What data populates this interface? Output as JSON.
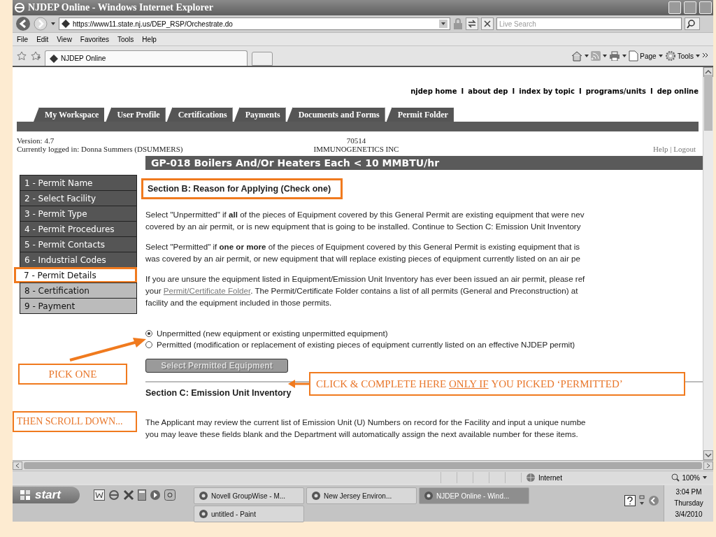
{
  "window": {
    "title": "NJDEP Online - Windows Internet Explorer"
  },
  "address_bar": {
    "url": "https://www11.state.nj.us/DEP_RSP/Orchestrate.do",
    "search_placeholder": "Live Search"
  },
  "menu": [
    "File",
    "Edit",
    "View",
    "Favorites",
    "Tools",
    "Help"
  ],
  "browser_tab": {
    "title": "NJDEP Online"
  },
  "command_bar": {
    "page": "Page",
    "tools": "Tools"
  },
  "top_links": [
    "njdep home",
    "about dep",
    "index by topic",
    "programs/units",
    "dep online"
  ],
  "top_link_separators": [
    "I",
    "I",
    "I",
    "I"
  ],
  "tabs": [
    {
      "label": "My Workspace"
    },
    {
      "label": "User Profile"
    },
    {
      "label": "Certifications"
    },
    {
      "label": "Payments"
    },
    {
      "label": "Documents and Forms"
    },
    {
      "label": "Permit Folder"
    }
  ],
  "info": {
    "version": "Version: 4.7",
    "logged_in": "Currently logged in: Donna Summers (DSUMMERS)",
    "number": "70514",
    "company": "IMMUNOGENETICS INC",
    "help": "Help",
    "separator": "|",
    "logout": "Logout"
  },
  "page_heading": "GP-018 Boilers And/Or Heaters Each < 10 MMBTU/hr",
  "steps": [
    {
      "label": "1 - Permit Name",
      "selected": false,
      "kind": "done"
    },
    {
      "label": "2 - Select Facility",
      "selected": false,
      "kind": "done"
    },
    {
      "label": "3 - Permit Type",
      "selected": false,
      "kind": "done"
    },
    {
      "label": "4 - Permit Procedures",
      "selected": false,
      "kind": "done"
    },
    {
      "label": "5 - Permit Contacts",
      "selected": false,
      "kind": "done"
    },
    {
      "label": "6 - Industrial Codes",
      "selected": false,
      "kind": "done"
    },
    {
      "label": "7 - Permit Details",
      "selected": true,
      "kind": "current"
    },
    {
      "label": "8 - Certification",
      "selected": false,
      "kind": "todo"
    },
    {
      "label": "9 - Payment",
      "selected": false,
      "kind": "todo"
    }
  ],
  "section_b": {
    "title": "Section B: Reason for Applying (Check one)",
    "paragraphs": [
      [
        "Select \"Unpermitted\" if **all** of the pieces of Equipment covered by this General Permit are existing equipment that were nev",
        "covered by an air permit, or is new equipment that is going to be installed. Continue to Section C: Emission Unit Inventory"
      ],
      [
        "Select \"Permitted\" if **one or more** of the pieces of Equipment covered by this General Permit is existing equipment that is",
        "was covered by an air permit, or new equipment that will replace existing pieces of equipment currently listed on an air pe"
      ]
    ],
    "folder_paragraph": {
      "line_1": "If you are unsure the equipment listed in Equipment/Emission Unit Inventory has ever been issued an air permit, please ref",
      "line_2_before": "your",
      "link": "Permit/Certificate Folder",
      "line_2_after": ". The Permit/Certificate Folder contains a list of all permits (General and Preconstruction) at",
      "line_3": "facility and the equipment included in those permits."
    },
    "options": [
      {
        "label": "Unpermitted (new equipment or existing unpermitted equipment)",
        "selected": true
      },
      {
        "label": "Permitted (modification or replacement of existing pieces of equipment currently listed on an effective NJDEP permit)",
        "selected": false
      }
    ],
    "button": {
      "label": "Select Permitted Equipment",
      "disabled": true
    }
  },
  "section_c": {
    "title": "Section C: Emission Unit Inventory",
    "lines": [
      "The Applicant may review the current list of Emission Unit (U) Numbers on record for the Facility and input a unique numbe",
      "you may leave these fields blank and the Department will automatically assign the next available number for these items."
    ]
  },
  "annotations": {
    "pick_one": "PICK ONE",
    "click_before": "CLICK & COMPLETE HERE",
    "click_underlined": "ONLY IF",
    "click_after": "YOU PICKED ‘PERMITTED’",
    "scroll_down": "THEN SCROLL DOWN..."
  },
  "status_bar": {
    "zone": "Internet",
    "zoom": "100%"
  },
  "taskbar": {
    "start": "start",
    "tasks": [
      {
        "label": "Novell GroupWise - M...",
        "selected": false
      },
      {
        "label": "New Jersey Environ...",
        "selected": false
      },
      {
        "label": "NJDEP Online - Wind...",
        "selected": true
      },
      {
        "label": "untitled - Paint",
        "selected": false
      }
    ],
    "time": "3:04 PM",
    "day": "Thursday",
    "date": "3/4/2010"
  }
}
